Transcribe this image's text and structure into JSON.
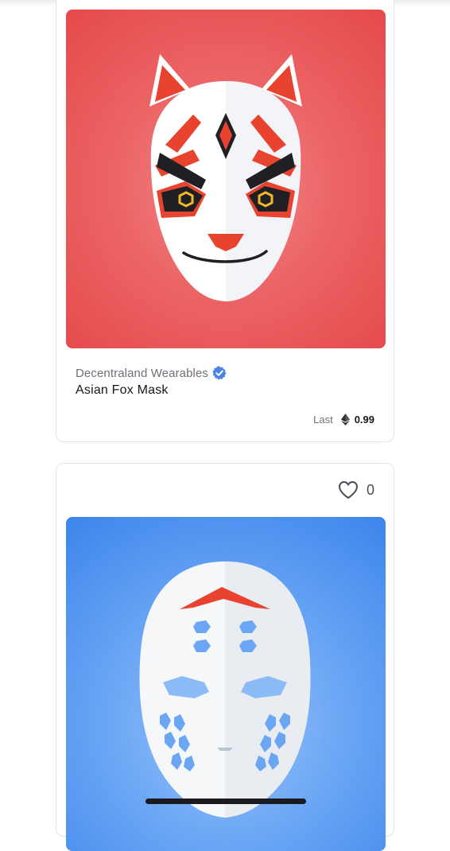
{
  "cards": [
    {
      "collection": "Decentraland Wearables",
      "name": "Asian Fox Mask",
      "price_label": "Last",
      "price_value": "0.99",
      "image_subject": "red fox mask",
      "background_color": "#e94f50"
    },
    {
      "likes": "0",
      "image_subject": "white mask",
      "background_color": "#4a8ef0"
    }
  ],
  "icons": {
    "verified": "verified-check-icon",
    "eth": "ethereum-icon",
    "heart": "heart-outline-icon"
  },
  "colors": {
    "verified_badge": "#4b84e6",
    "mask_accent_red": "#e8432e"
  }
}
